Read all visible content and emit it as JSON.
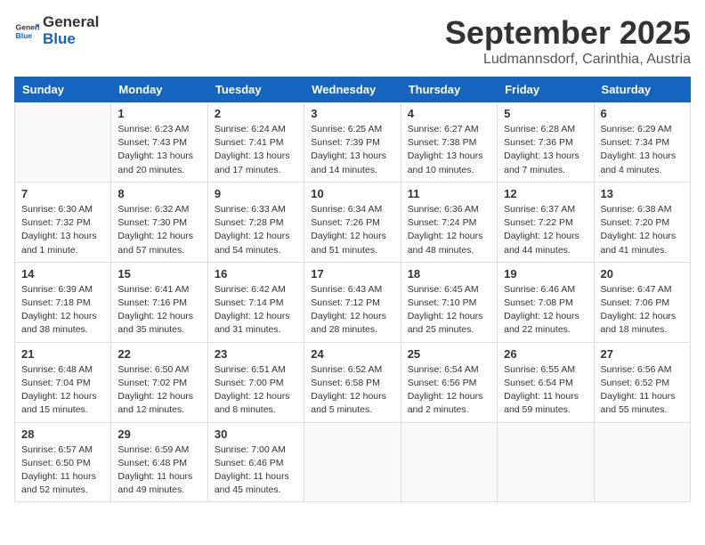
{
  "logo": {
    "general": "General",
    "blue": "Blue"
  },
  "header": {
    "month": "September 2025",
    "location": "Ludmannsdorf, Carinthia, Austria"
  },
  "days_of_week": [
    "Sunday",
    "Monday",
    "Tuesday",
    "Wednesday",
    "Thursday",
    "Friday",
    "Saturday"
  ],
  "weeks": [
    [
      {
        "day": null,
        "info": null
      },
      {
        "day": "1",
        "info": "Sunrise: 6:23 AM\nSunset: 7:43 PM\nDaylight: 13 hours\nand 20 minutes."
      },
      {
        "day": "2",
        "info": "Sunrise: 6:24 AM\nSunset: 7:41 PM\nDaylight: 13 hours\nand 17 minutes."
      },
      {
        "day": "3",
        "info": "Sunrise: 6:25 AM\nSunset: 7:39 PM\nDaylight: 13 hours\nand 14 minutes."
      },
      {
        "day": "4",
        "info": "Sunrise: 6:27 AM\nSunset: 7:38 PM\nDaylight: 13 hours\nand 10 minutes."
      },
      {
        "day": "5",
        "info": "Sunrise: 6:28 AM\nSunset: 7:36 PM\nDaylight: 13 hours\nand 7 minutes."
      },
      {
        "day": "6",
        "info": "Sunrise: 6:29 AM\nSunset: 7:34 PM\nDaylight: 13 hours\nand 4 minutes."
      }
    ],
    [
      {
        "day": "7",
        "info": "Sunrise: 6:30 AM\nSunset: 7:32 PM\nDaylight: 13 hours\nand 1 minute."
      },
      {
        "day": "8",
        "info": "Sunrise: 6:32 AM\nSunset: 7:30 PM\nDaylight: 12 hours\nand 57 minutes."
      },
      {
        "day": "9",
        "info": "Sunrise: 6:33 AM\nSunset: 7:28 PM\nDaylight: 12 hours\nand 54 minutes."
      },
      {
        "day": "10",
        "info": "Sunrise: 6:34 AM\nSunset: 7:26 PM\nDaylight: 12 hours\nand 51 minutes."
      },
      {
        "day": "11",
        "info": "Sunrise: 6:36 AM\nSunset: 7:24 PM\nDaylight: 12 hours\nand 48 minutes."
      },
      {
        "day": "12",
        "info": "Sunrise: 6:37 AM\nSunset: 7:22 PM\nDaylight: 12 hours\nand 44 minutes."
      },
      {
        "day": "13",
        "info": "Sunrise: 6:38 AM\nSunset: 7:20 PM\nDaylight: 12 hours\nand 41 minutes."
      }
    ],
    [
      {
        "day": "14",
        "info": "Sunrise: 6:39 AM\nSunset: 7:18 PM\nDaylight: 12 hours\nand 38 minutes."
      },
      {
        "day": "15",
        "info": "Sunrise: 6:41 AM\nSunset: 7:16 PM\nDaylight: 12 hours\nand 35 minutes."
      },
      {
        "day": "16",
        "info": "Sunrise: 6:42 AM\nSunset: 7:14 PM\nDaylight: 12 hours\nand 31 minutes."
      },
      {
        "day": "17",
        "info": "Sunrise: 6:43 AM\nSunset: 7:12 PM\nDaylight: 12 hours\nand 28 minutes."
      },
      {
        "day": "18",
        "info": "Sunrise: 6:45 AM\nSunset: 7:10 PM\nDaylight: 12 hours\nand 25 minutes."
      },
      {
        "day": "19",
        "info": "Sunrise: 6:46 AM\nSunset: 7:08 PM\nDaylight: 12 hours\nand 22 minutes."
      },
      {
        "day": "20",
        "info": "Sunrise: 6:47 AM\nSunset: 7:06 PM\nDaylight: 12 hours\nand 18 minutes."
      }
    ],
    [
      {
        "day": "21",
        "info": "Sunrise: 6:48 AM\nSunset: 7:04 PM\nDaylight: 12 hours\nand 15 minutes."
      },
      {
        "day": "22",
        "info": "Sunrise: 6:50 AM\nSunset: 7:02 PM\nDaylight: 12 hours\nand 12 minutes."
      },
      {
        "day": "23",
        "info": "Sunrise: 6:51 AM\nSunset: 7:00 PM\nDaylight: 12 hours\nand 8 minutes."
      },
      {
        "day": "24",
        "info": "Sunrise: 6:52 AM\nSunset: 6:58 PM\nDaylight: 12 hours\nand 5 minutes."
      },
      {
        "day": "25",
        "info": "Sunrise: 6:54 AM\nSunset: 6:56 PM\nDaylight: 12 hours\nand 2 minutes."
      },
      {
        "day": "26",
        "info": "Sunrise: 6:55 AM\nSunset: 6:54 PM\nDaylight: 11 hours\nand 59 minutes."
      },
      {
        "day": "27",
        "info": "Sunrise: 6:56 AM\nSunset: 6:52 PM\nDaylight: 11 hours\nand 55 minutes."
      }
    ],
    [
      {
        "day": "28",
        "info": "Sunrise: 6:57 AM\nSunset: 6:50 PM\nDaylight: 11 hours\nand 52 minutes."
      },
      {
        "day": "29",
        "info": "Sunrise: 6:59 AM\nSunset: 6:48 PM\nDaylight: 11 hours\nand 49 minutes."
      },
      {
        "day": "30",
        "info": "Sunrise: 7:00 AM\nSunset: 6:46 PM\nDaylight: 11 hours\nand 45 minutes."
      },
      {
        "day": null,
        "info": null
      },
      {
        "day": null,
        "info": null
      },
      {
        "day": null,
        "info": null
      },
      {
        "day": null,
        "info": null
      }
    ]
  ]
}
